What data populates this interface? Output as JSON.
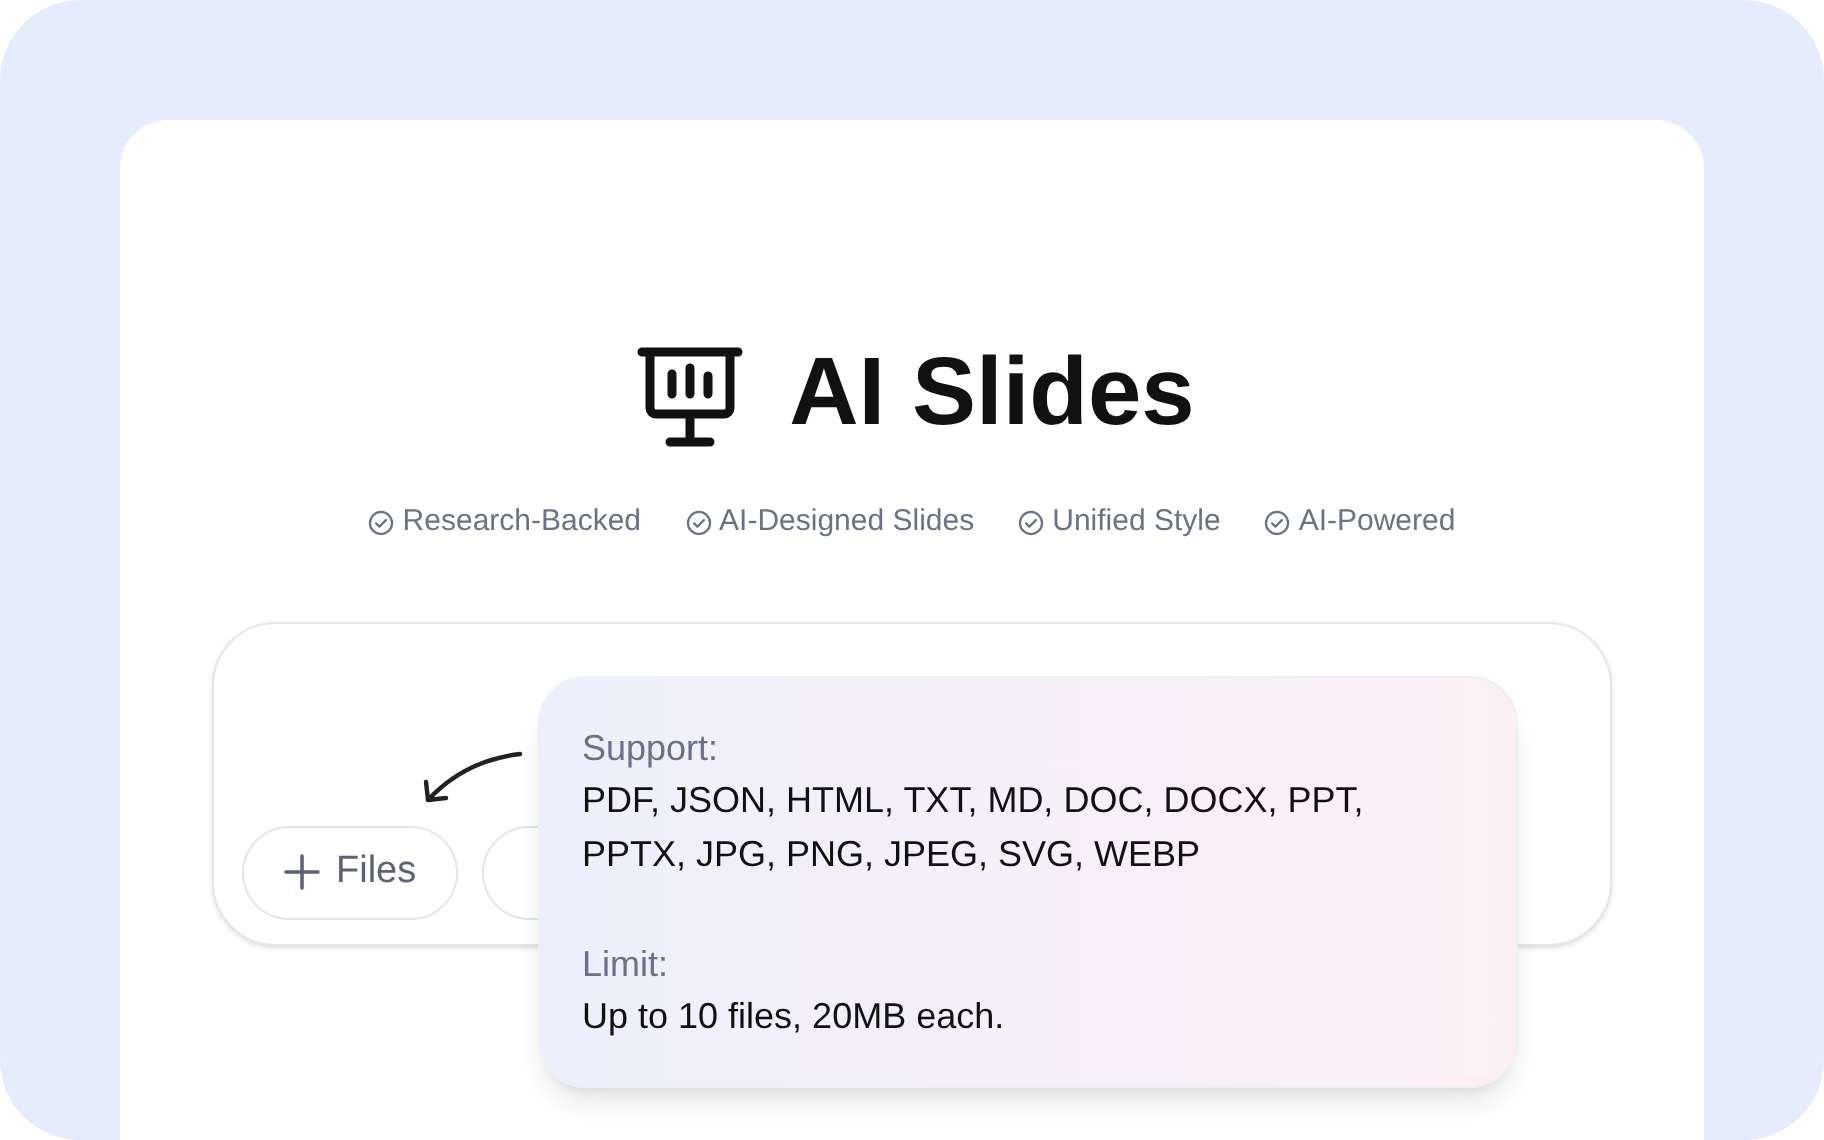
{
  "title": "AI Slides",
  "features": [
    "Research-Backed",
    "AI-Designed Slides",
    "Unified Style",
    "AI-Powered"
  ],
  "files_button": {
    "label": "Files"
  },
  "tooltip": {
    "sections": [
      {
        "heading": "Support:",
        "text": "PDF, JSON, HTML, TXT, MD, DOC, DOCX, PPT, PPTX, JPG, PNG, JPEG, SVG, WEBP"
      },
      {
        "heading": "Limit:",
        "text": "Up to 10 files, 20MB each."
      }
    ]
  }
}
